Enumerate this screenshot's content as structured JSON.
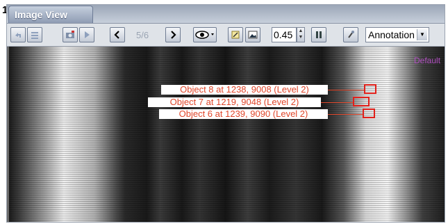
{
  "figure_number": "1",
  "window": {
    "tab_title": "Image View"
  },
  "toolbar": {
    "page_counter": "5/6",
    "zoom_value": "0.45",
    "mode_select": {
      "selected": "Annotation"
    }
  },
  "viewer": {
    "overlay_label": "Default",
    "annotations": [
      {
        "text": "Object 8 at 1238, 9008 (Level 2)"
      },
      {
        "text": "Object 7 at 1219, 9048 (Level 2)"
      },
      {
        "text": "Object 6 at 1239, 9090 (Level 2)"
      }
    ]
  }
}
